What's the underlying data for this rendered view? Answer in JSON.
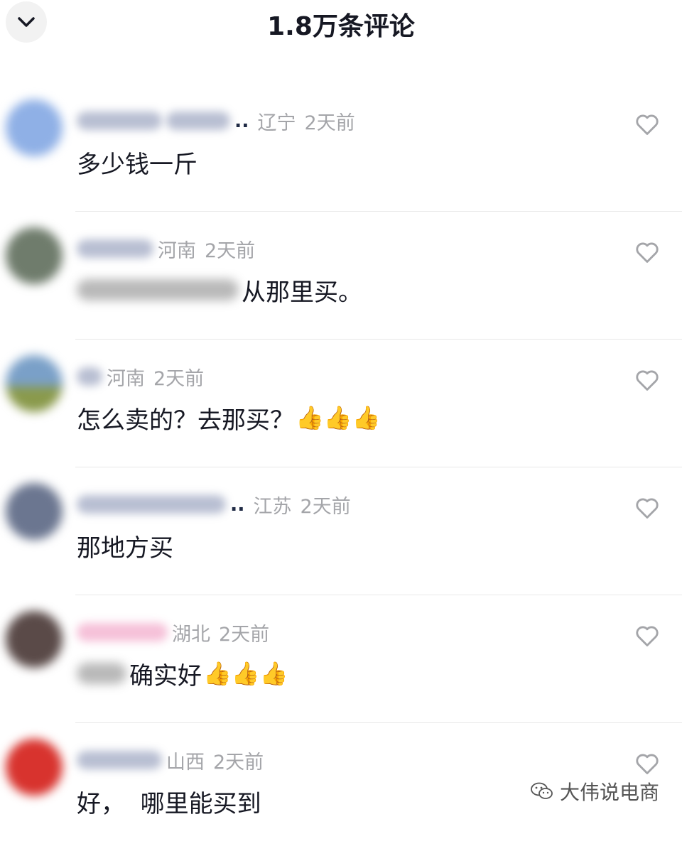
{
  "header": {
    "title": "1.8万条评论",
    "collapse_icon": "chevron-down-icon"
  },
  "comments": [
    {
      "ellipsis": "..",
      "location": "辽宁",
      "time": "2天前",
      "text": "多少钱一斤",
      "emoji": "",
      "avatar_color": "#8fb0e6"
    },
    {
      "ellipsis": "",
      "location": "河南",
      "time": "2天前",
      "text": "从那里买。",
      "emoji": "",
      "avatar_color": "#6f7c6c"
    },
    {
      "ellipsis": "",
      "location": "河南",
      "time": "2天前",
      "text": "怎么卖的？去那买？",
      "emoji": "👍👍👍",
      "avatar_color": "#7aa0c8"
    },
    {
      "ellipsis": "..",
      "location": "江苏",
      "time": "2天前",
      "text": "那地方买",
      "emoji": "",
      "avatar_color": "#6b7690"
    },
    {
      "ellipsis": "",
      "location": "湖北",
      "time": "2天前",
      "text": "确实好",
      "emoji": "👍👍👍",
      "avatar_color": "#5a4a48"
    },
    {
      "ellipsis": "",
      "location": "山西",
      "time": "2天前",
      "text": "好，  哪里能买到",
      "emoji": "",
      "avatar_color": "#d8332e"
    }
  ],
  "like_icon": "heart-outline-icon",
  "watermark": {
    "text": "大伟说电商",
    "icon": "wechat-icon"
  }
}
